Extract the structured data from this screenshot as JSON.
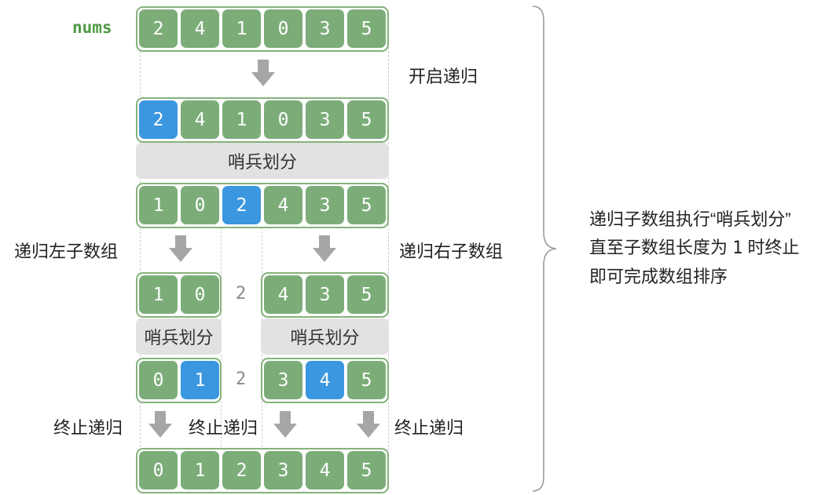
{
  "array_label": "nums",
  "step_labels": {
    "start_recursion": "开启递归",
    "partition": "哨兵划分",
    "recurse_left": "递归左子数组",
    "recurse_right": "递归右子数组",
    "terminate": "终止递归"
  },
  "rows": {
    "initial": [
      "2",
      "4",
      "1",
      "0",
      "3",
      "5"
    ],
    "pivot_selected": [
      "2",
      "4",
      "1",
      "0",
      "3",
      "5"
    ],
    "after_partition": [
      "1",
      "0",
      "2",
      "4",
      "3",
      "5"
    ],
    "left_sub": [
      "1",
      "0"
    ],
    "right_sub": [
      "4",
      "3",
      "5"
    ],
    "left_partitioned": [
      "0",
      "1"
    ],
    "right_partitioned": [
      "3",
      "4",
      "5"
    ],
    "sorted": [
      "0",
      "1",
      "2",
      "3",
      "4",
      "5"
    ]
  },
  "pivot_value": "2",
  "summary": {
    "line1": "递归子数组执行“哨兵划分”",
    "line2_pre": "直至子数组长度为",
    "line2_num": "1",
    "line2_post": "时终止",
    "line3": "即可完成数组排序"
  },
  "colors": {
    "cell_green": "#7cad79",
    "cell_pivot_blue": "#3a97e0",
    "box_border": "#85b27b",
    "label_green": "#4f9a45",
    "band_gray": "#e2e2e2",
    "arrow_gray": "#a6a6a6"
  }
}
